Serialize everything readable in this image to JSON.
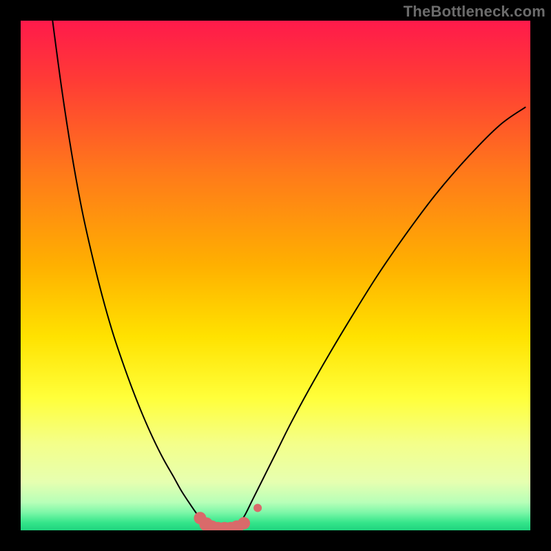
{
  "watermark": "TheBottleneck.com",
  "chart_data": {
    "type": "line",
    "title": "",
    "xlabel": "",
    "ylabel": "",
    "xlim": [
      0,
      1
    ],
    "ylim": [
      0,
      1
    ],
    "grid": false,
    "legend": false,
    "background_gradient": {
      "stops": [
        {
          "offset": 0.0,
          "color": "#ff1a4b"
        },
        {
          "offset": 0.12,
          "color": "#ff3c35"
        },
        {
          "offset": 0.3,
          "color": "#ff7a1a"
        },
        {
          "offset": 0.48,
          "color": "#ffb000"
        },
        {
          "offset": 0.62,
          "color": "#ffe200"
        },
        {
          "offset": 0.74,
          "color": "#ffff3a"
        },
        {
          "offset": 0.83,
          "color": "#f4ff8a"
        },
        {
          "offset": 0.905,
          "color": "#e6ffb0"
        },
        {
          "offset": 0.945,
          "color": "#b8ffb8"
        },
        {
          "offset": 0.965,
          "color": "#7df7a8"
        },
        {
          "offset": 0.985,
          "color": "#34e58a"
        },
        {
          "offset": 1.0,
          "color": "#1fd47e"
        }
      ]
    },
    "series": [
      {
        "name": "left-curve",
        "color": "#000000",
        "x": [
          0.06,
          0.08,
          0.1,
          0.12,
          0.14,
          0.16,
          0.18,
          0.2,
          0.22,
          0.24,
          0.26,
          0.28,
          0.3,
          0.315,
          0.33,
          0.343,
          0.352,
          0.36
        ],
        "y": [
          1.02,
          0.87,
          0.74,
          0.63,
          0.54,
          0.46,
          0.39,
          0.33,
          0.275,
          0.225,
          0.18,
          0.14,
          0.105,
          0.078,
          0.055,
          0.036,
          0.024,
          0.015
        ]
      },
      {
        "name": "right-curve",
        "color": "#000000",
        "x": [
          0.43,
          0.44,
          0.455,
          0.475,
          0.5,
          0.53,
          0.565,
          0.605,
          0.65,
          0.7,
          0.755,
          0.815,
          0.88,
          0.94,
          0.99
        ],
        "y": [
          0.015,
          0.03,
          0.06,
          0.1,
          0.15,
          0.21,
          0.275,
          0.345,
          0.42,
          0.5,
          0.58,
          0.66,
          0.735,
          0.795,
          0.83
        ]
      },
      {
        "name": "marker-band",
        "type": "markers",
        "color": "#d96a6a",
        "x": [
          0.352,
          0.364,
          0.375,
          0.387,
          0.4,
          0.412,
          0.424,
          0.438,
          0.465
        ],
        "y": [
          0.024,
          0.012,
          0.006,
          0.003,
          0.003,
          0.003,
          0.006,
          0.014,
          0.044
        ],
        "size": [
          9,
          10,
          10,
          10,
          10,
          10,
          10,
          9,
          6
        ]
      }
    ]
  }
}
